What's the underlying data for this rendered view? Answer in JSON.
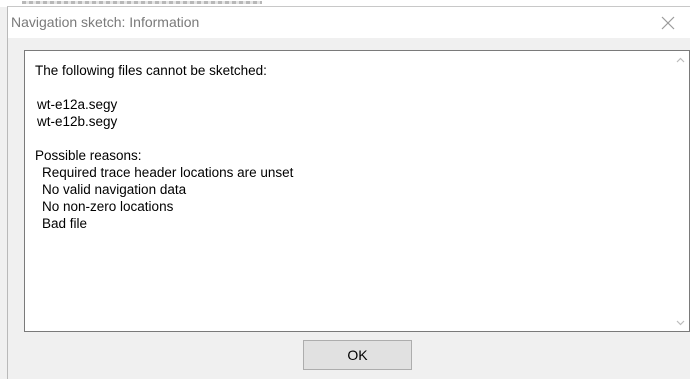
{
  "dialog": {
    "title": "Navigation sketch: Information",
    "close_icon": "close-icon",
    "message": {
      "heading": "The following files cannot be sketched:",
      "files": [
        "wt-e12a.segy",
        "wt-e12b.segy"
      ],
      "reasons_heading": "Possible reasons:",
      "reasons": [
        "Required trace header locations are unset",
        "No valid navigation data",
        "No non-zero locations",
        "Bad file"
      ]
    },
    "ok_label": "OK"
  },
  "colors": {
    "dialog_bg": "#f0f0f0",
    "title_bg": "#ffffff",
    "title_text": "#7a7a7a",
    "panel_border": "#7a7a7a",
    "button_bg": "#e1e1e1",
    "button_border": "#adadad"
  }
}
